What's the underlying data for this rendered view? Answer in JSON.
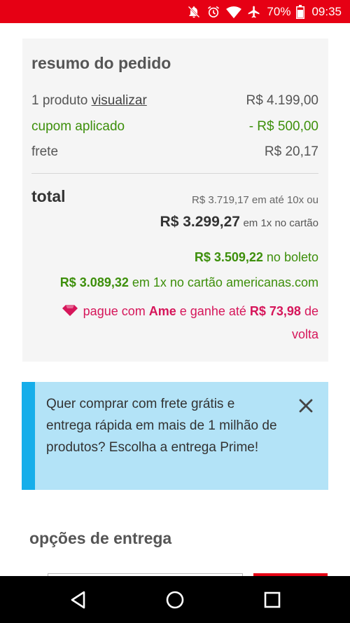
{
  "status_bar": {
    "battery": "70%",
    "time": "09:35",
    "icons": [
      "notifications-off-icon",
      "alarm-icon",
      "wifi-icon",
      "airplane-icon",
      "battery-icon"
    ]
  },
  "summary": {
    "title": "resumo do pedido",
    "product_prefix": "1 produto",
    "product_link": "visualizar",
    "product_value": "R$ 4.199,00",
    "coupon_label": "cupom aplicado",
    "coupon_value": "- R$ 500,00",
    "shipping_label": "frete",
    "shipping_value": "R$ 20,17",
    "total_label": "total",
    "installments_text": "R$ 3.719,17 em até 10x ou",
    "cash_amount": "R$ 3.299,27",
    "cash_suffix": "em 1x no cartão",
    "boleto_amount": "R$ 3.509,22",
    "boleto_suffix": "no boleto",
    "store_card_amount": "R$ 3.089,32",
    "store_card_suffix": "em 1x no cartão americanas.com",
    "ame_prefix": "pague com",
    "ame_brand": "Ame",
    "ame_middle": "e ganhe até",
    "ame_amount": "R$ 73,98",
    "ame_suffix": "de volta"
  },
  "prime_banner": {
    "text": "Quer comprar com frete grátis e entrega rápida em mais de 1 milhão de produtos? Escolha a entrega Prime!"
  },
  "delivery": {
    "title": "opções de entrega"
  },
  "colors": {
    "brand_red": "#e60014",
    "green": "#3d8f0b",
    "ame_pink": "#d6165a",
    "banner_bg": "#b3e3f7",
    "banner_accent": "#16aeea"
  }
}
